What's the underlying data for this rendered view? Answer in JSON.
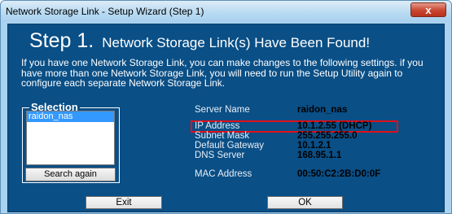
{
  "window": {
    "title": "Network Storage Link - Setup Wizard (Step 1)",
    "close_glyph": "x"
  },
  "step": {
    "number_text": "Step 1.",
    "heading": "Network Storage Link(s) Have Been Found!",
    "description": "If you have one Network Storage Link, you can make changes to the following settings. if you have more than one Network Storage Link, you will need to run the Setup Utility again to configure each separate Network Storage Link."
  },
  "selection": {
    "legend": "Selection",
    "items": [
      "raidon_nas"
    ],
    "selected_index": 0,
    "search_button": "Search again"
  },
  "info": {
    "server_name": {
      "label": "Server Name",
      "value": "raidon_nas"
    },
    "ip_address": {
      "label": "IP Address",
      "value": "10.1.2.55 (DHCP)"
    },
    "subnet_mask": {
      "label": "Subnet Mask",
      "value": "255.255.255.0"
    },
    "default_gateway": {
      "label": "Default Gateway",
      "value": "10.1.2.1"
    },
    "dns_server": {
      "label": "DNS Server",
      "value": "168.95.1.1"
    },
    "mac_address": {
      "label": "MAC Address",
      "value": "00:50:C2:2B:D0:0F"
    }
  },
  "buttons": {
    "exit": "Exit",
    "ok": "OK"
  },
  "colors": {
    "panel_bg": "#0a4f86",
    "highlight_border": "#e0101a",
    "selected_item": "#3399ff"
  }
}
